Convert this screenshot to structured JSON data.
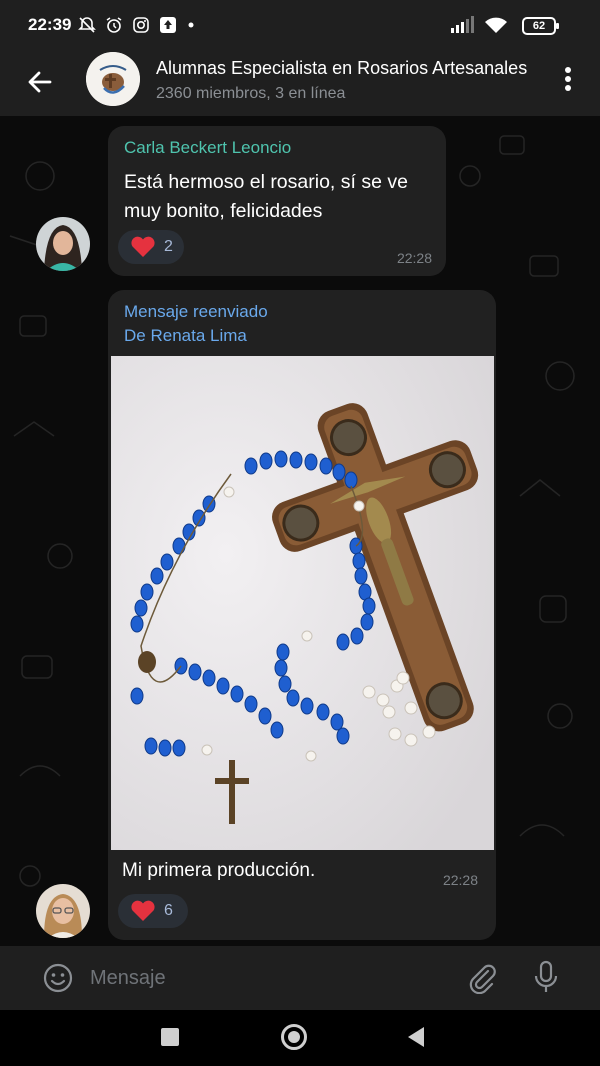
{
  "status_bar": {
    "time": "22:39",
    "battery": "62",
    "icons_left": [
      "do-not-disturb-icon",
      "alarm-icon",
      "instagram-icon",
      "upload-icon",
      "dot-icon"
    ],
    "icons_right": [
      "signal-icon",
      "wifi-icon",
      "battery-icon"
    ]
  },
  "header": {
    "title": "Alumnas Especialista en Rosarios Artesanales",
    "subtitle": "2360 miembros, 3 en línea"
  },
  "messages": [
    {
      "sender": "Carla Beckert Leoncio",
      "text": "Está hermoso el rosario, sí se ve muy bonito, felicidades",
      "reaction_count": "2",
      "time": "22:28"
    },
    {
      "forward_label": "Mensaje reenviado",
      "forward_prefix": "De",
      "forward_from": "Renata Lima",
      "caption": "Mi primera producción.",
      "reaction_count": "6",
      "time": "22:28"
    }
  ],
  "input": {
    "placeholder": "Mensaje"
  },
  "colors": {
    "accent_sender": "#4fc4ae",
    "forward": "#6aa9ec",
    "bubble": "#212121",
    "reaction_heart": "#e5323f"
  }
}
